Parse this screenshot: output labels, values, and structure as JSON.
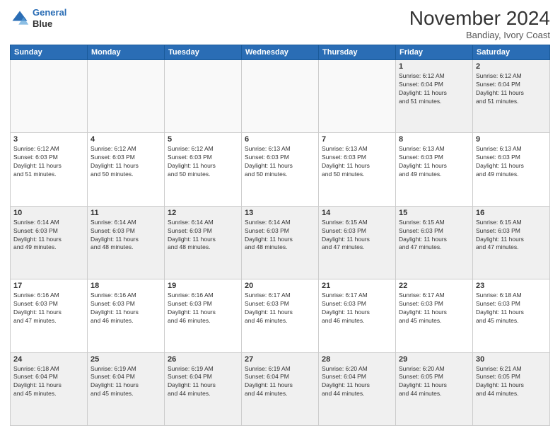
{
  "header": {
    "logo_line1": "General",
    "logo_line2": "Blue",
    "month_title": "November 2024",
    "location": "Bandiay, Ivory Coast"
  },
  "weekdays": [
    "Sunday",
    "Monday",
    "Tuesday",
    "Wednesday",
    "Thursday",
    "Friday",
    "Saturday"
  ],
  "weeks": [
    [
      {
        "day": "",
        "info": ""
      },
      {
        "day": "",
        "info": ""
      },
      {
        "day": "",
        "info": ""
      },
      {
        "day": "",
        "info": ""
      },
      {
        "day": "",
        "info": ""
      },
      {
        "day": "1",
        "info": "Sunrise: 6:12 AM\nSunset: 6:04 PM\nDaylight: 11 hours\nand 51 minutes."
      },
      {
        "day": "2",
        "info": "Sunrise: 6:12 AM\nSunset: 6:04 PM\nDaylight: 11 hours\nand 51 minutes."
      }
    ],
    [
      {
        "day": "3",
        "info": "Sunrise: 6:12 AM\nSunset: 6:03 PM\nDaylight: 11 hours\nand 51 minutes."
      },
      {
        "day": "4",
        "info": "Sunrise: 6:12 AM\nSunset: 6:03 PM\nDaylight: 11 hours\nand 50 minutes."
      },
      {
        "day": "5",
        "info": "Sunrise: 6:12 AM\nSunset: 6:03 PM\nDaylight: 11 hours\nand 50 minutes."
      },
      {
        "day": "6",
        "info": "Sunrise: 6:13 AM\nSunset: 6:03 PM\nDaylight: 11 hours\nand 50 minutes."
      },
      {
        "day": "7",
        "info": "Sunrise: 6:13 AM\nSunset: 6:03 PM\nDaylight: 11 hours\nand 50 minutes."
      },
      {
        "day": "8",
        "info": "Sunrise: 6:13 AM\nSunset: 6:03 PM\nDaylight: 11 hours\nand 49 minutes."
      },
      {
        "day": "9",
        "info": "Sunrise: 6:13 AM\nSunset: 6:03 PM\nDaylight: 11 hours\nand 49 minutes."
      }
    ],
    [
      {
        "day": "10",
        "info": "Sunrise: 6:14 AM\nSunset: 6:03 PM\nDaylight: 11 hours\nand 49 minutes."
      },
      {
        "day": "11",
        "info": "Sunrise: 6:14 AM\nSunset: 6:03 PM\nDaylight: 11 hours\nand 48 minutes."
      },
      {
        "day": "12",
        "info": "Sunrise: 6:14 AM\nSunset: 6:03 PM\nDaylight: 11 hours\nand 48 minutes."
      },
      {
        "day": "13",
        "info": "Sunrise: 6:14 AM\nSunset: 6:03 PM\nDaylight: 11 hours\nand 48 minutes."
      },
      {
        "day": "14",
        "info": "Sunrise: 6:15 AM\nSunset: 6:03 PM\nDaylight: 11 hours\nand 47 minutes."
      },
      {
        "day": "15",
        "info": "Sunrise: 6:15 AM\nSunset: 6:03 PM\nDaylight: 11 hours\nand 47 minutes."
      },
      {
        "day": "16",
        "info": "Sunrise: 6:15 AM\nSunset: 6:03 PM\nDaylight: 11 hours\nand 47 minutes."
      }
    ],
    [
      {
        "day": "17",
        "info": "Sunrise: 6:16 AM\nSunset: 6:03 PM\nDaylight: 11 hours\nand 47 minutes."
      },
      {
        "day": "18",
        "info": "Sunrise: 6:16 AM\nSunset: 6:03 PM\nDaylight: 11 hours\nand 46 minutes."
      },
      {
        "day": "19",
        "info": "Sunrise: 6:16 AM\nSunset: 6:03 PM\nDaylight: 11 hours\nand 46 minutes."
      },
      {
        "day": "20",
        "info": "Sunrise: 6:17 AM\nSunset: 6:03 PM\nDaylight: 11 hours\nand 46 minutes."
      },
      {
        "day": "21",
        "info": "Sunrise: 6:17 AM\nSunset: 6:03 PM\nDaylight: 11 hours\nand 46 minutes."
      },
      {
        "day": "22",
        "info": "Sunrise: 6:17 AM\nSunset: 6:03 PM\nDaylight: 11 hours\nand 45 minutes."
      },
      {
        "day": "23",
        "info": "Sunrise: 6:18 AM\nSunset: 6:03 PM\nDaylight: 11 hours\nand 45 minutes."
      }
    ],
    [
      {
        "day": "24",
        "info": "Sunrise: 6:18 AM\nSunset: 6:04 PM\nDaylight: 11 hours\nand 45 minutes."
      },
      {
        "day": "25",
        "info": "Sunrise: 6:19 AM\nSunset: 6:04 PM\nDaylight: 11 hours\nand 45 minutes."
      },
      {
        "day": "26",
        "info": "Sunrise: 6:19 AM\nSunset: 6:04 PM\nDaylight: 11 hours\nand 44 minutes."
      },
      {
        "day": "27",
        "info": "Sunrise: 6:19 AM\nSunset: 6:04 PM\nDaylight: 11 hours\nand 44 minutes."
      },
      {
        "day": "28",
        "info": "Sunrise: 6:20 AM\nSunset: 6:04 PM\nDaylight: 11 hours\nand 44 minutes."
      },
      {
        "day": "29",
        "info": "Sunrise: 6:20 AM\nSunset: 6:05 PM\nDaylight: 11 hours\nand 44 minutes."
      },
      {
        "day": "30",
        "info": "Sunrise: 6:21 AM\nSunset: 6:05 PM\nDaylight: 11 hours\nand 44 minutes."
      }
    ]
  ]
}
